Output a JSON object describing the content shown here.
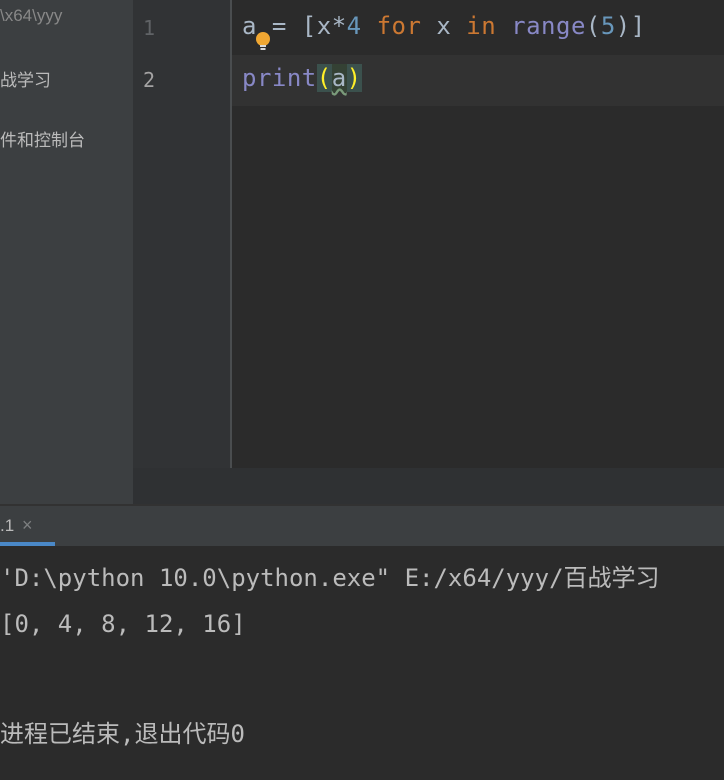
{
  "project_panel": {
    "items": [
      {
        "label": "\\x64\\yyy"
      },
      {
        "label": "战学习"
      },
      {
        "label": "件和控制台"
      }
    ]
  },
  "editor": {
    "line_numbers": [
      "1",
      "2"
    ],
    "line1": {
      "var": "a",
      "assign": " = [x*",
      "num4": "4",
      "sp1": " ",
      "kw_for": "for",
      "mid": " x ",
      "kw_in": "in",
      "sp2": " ",
      "fn_range": "range",
      "lp": "(",
      "num5": "5",
      "rp": ")]"
    },
    "line2": {
      "fn_print": "print",
      "lp": "(",
      "arg": "a",
      "rp": ")"
    }
  },
  "run_panel": {
    "tab_label": ".1",
    "close_glyph": "×",
    "lines": [
      "'D:\\python 10.0\\python.exe\" E:/x64/yyy/百战学习",
      "[0, 4, 8, 12, 16]",
      "",
      "进程已结束,退出代码0"
    ]
  },
  "colors": {
    "keyword": "#cc7832",
    "builtin": "#8888c6",
    "number": "#6897bb",
    "accent_tab": "#4a88c7"
  }
}
